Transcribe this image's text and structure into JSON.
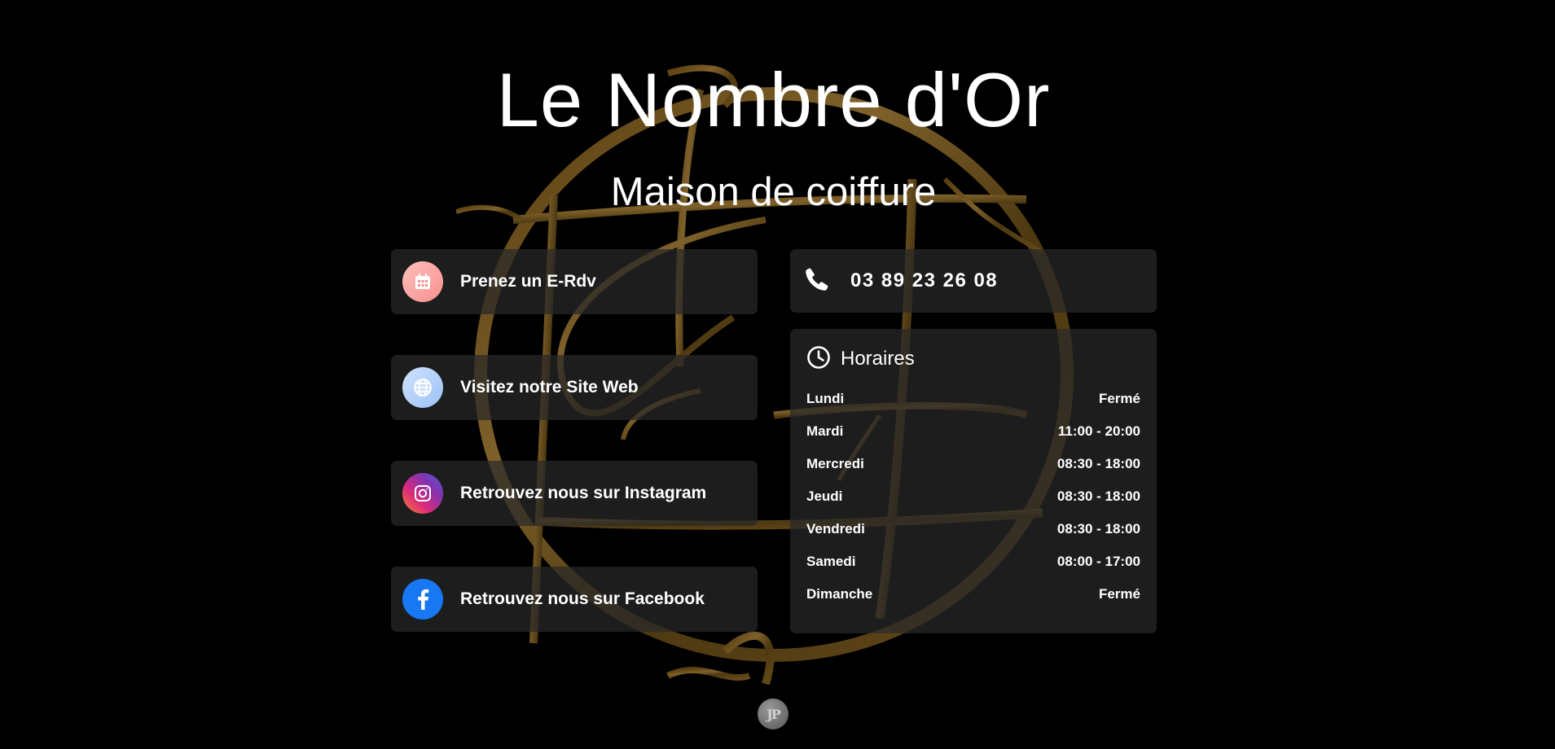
{
  "header": {
    "title": "Le Nombre d'Or",
    "subtitle": "Maison de coiffure"
  },
  "links": [
    {
      "label": "Prenez un E-Rdv",
      "icon": "calendar-icon"
    },
    {
      "label": "Visitez notre Site Web",
      "icon": "globe-icon"
    },
    {
      "label": "Retrouvez nous sur Instagram",
      "icon": "instagram-icon"
    },
    {
      "label": "Retrouvez nous sur Facebook",
      "icon": "facebook-icon"
    }
  ],
  "contact": {
    "phone": "03 89 23 26 08",
    "icon": "phone-icon"
  },
  "hours": {
    "title": "Horaires",
    "icon": "clock-icon",
    "days": [
      {
        "day": "Lundi",
        "time": "Fermé"
      },
      {
        "day": "Mardi",
        "time": "11:00 - 20:00"
      },
      {
        "day": "Mercredi",
        "time": "08:30 - 18:00"
      },
      {
        "day": "Jeudi",
        "time": "08:30 - 18:00"
      },
      {
        "day": "Vendredi",
        "time": "08:30 - 18:00"
      },
      {
        "day": "Samedi",
        "time": "08:00 - 17:00"
      },
      {
        "day": "Dimanche",
        "time": "Fermé"
      }
    ]
  },
  "footer": {
    "logo": "JP"
  },
  "colors": {
    "background": "#000000",
    "card": "#282828",
    "gold": "#8a6a2a",
    "text": "#ffffff"
  }
}
